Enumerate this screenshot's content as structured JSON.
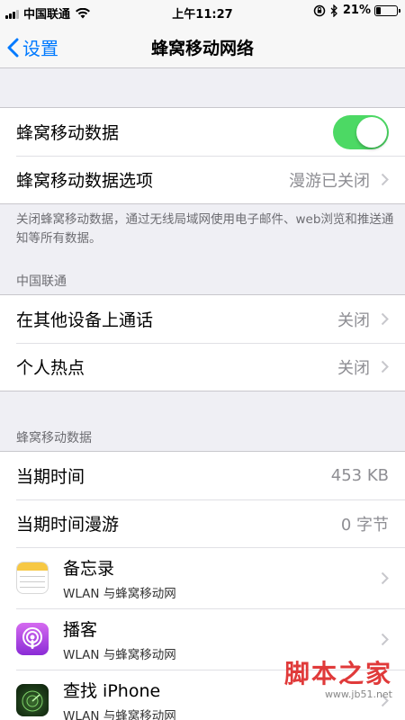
{
  "status_bar": {
    "carrier": "中国联通",
    "time": "上午11:27",
    "battery_percent": "21%",
    "battery_level": 0.21,
    "icons": [
      "signal-icon",
      "wifi-icon",
      "orientation-lock-icon",
      "bluetooth-icon",
      "battery-icon"
    ]
  },
  "nav": {
    "back_label": "设置",
    "title": "蜂窝移动网络"
  },
  "group1": {
    "cellular_data_label": "蜂窝移动数据",
    "cellular_data_on": true,
    "options_label": "蜂窝移动数据选项",
    "options_value": "漫游已关闭"
  },
  "footer_note": "关闭蜂窝移动数据，通过无线局域网使用电子邮件、web浏览和推送通知等所有数据。",
  "carrier_section": {
    "header": "中国联通",
    "calls_label": "在其他设备上通话",
    "calls_value": "关闭",
    "hotspot_label": "个人热点",
    "hotspot_value": "关闭"
  },
  "usage_section": {
    "header": "蜂窝移动数据",
    "current_period_label": "当期时间",
    "current_period_value": "453 KB",
    "current_roaming_label": "当期时间漫游",
    "current_roaming_value": "0 字节"
  },
  "apps": [
    {
      "name": "备忘录",
      "sub": "WLAN 与蜂窝移动网",
      "icon": "notes-icon"
    },
    {
      "name": "播客",
      "sub": "WLAN 与蜂窝移动网",
      "icon": "podcasts-icon"
    },
    {
      "name": "查找 iPhone",
      "sub": "WLAN 与蜂窝移动网",
      "icon": "find-iphone-icon"
    }
  ],
  "watermark": {
    "main": "脚本之家",
    "url": "www.jb51.net"
  },
  "colors": {
    "accent": "#007aff",
    "toggle_on": "#4cd964",
    "background": "#efeff4",
    "secondary_text": "#8e8e93"
  }
}
